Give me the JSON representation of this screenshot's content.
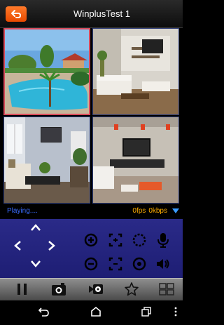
{
  "header": {
    "title": "WinplusTest 1"
  },
  "status": {
    "text": "Playing....",
    "fps": "0fps",
    "bitrate": "0kbps"
  },
  "cameras": [
    {
      "name": "camera-view-1",
      "selected": true
    },
    {
      "name": "camera-view-2",
      "selected": false
    },
    {
      "name": "camera-view-3",
      "selected": false
    },
    {
      "name": "camera-view-4",
      "selected": false
    }
  ],
  "ptz_controls": [
    "up-arrow-icon",
    "down-arrow-icon",
    "left-arrow-icon",
    "right-arrow-icon",
    "zoom-in-icon",
    "zoom-out-icon",
    "focus-near-icon",
    "focus-far-icon",
    "iris-open-icon",
    "iris-close-icon",
    "microphone-icon",
    "speaker-icon"
  ],
  "toolbar": [
    "pause-icon",
    "snapshot-icon",
    "record-icon",
    "favorite-icon",
    "layout-grid-icon"
  ],
  "navbar": [
    "back-nav-icon",
    "home-nav-icon",
    "recents-nav-icon",
    "menu-nav-icon"
  ],
  "colors": {
    "accent": "#ff6a00",
    "selected_border": "#d84a5a",
    "status_text": "#3a6cff",
    "stats_text": "#ffae00",
    "panel_bg": "#24247e"
  }
}
